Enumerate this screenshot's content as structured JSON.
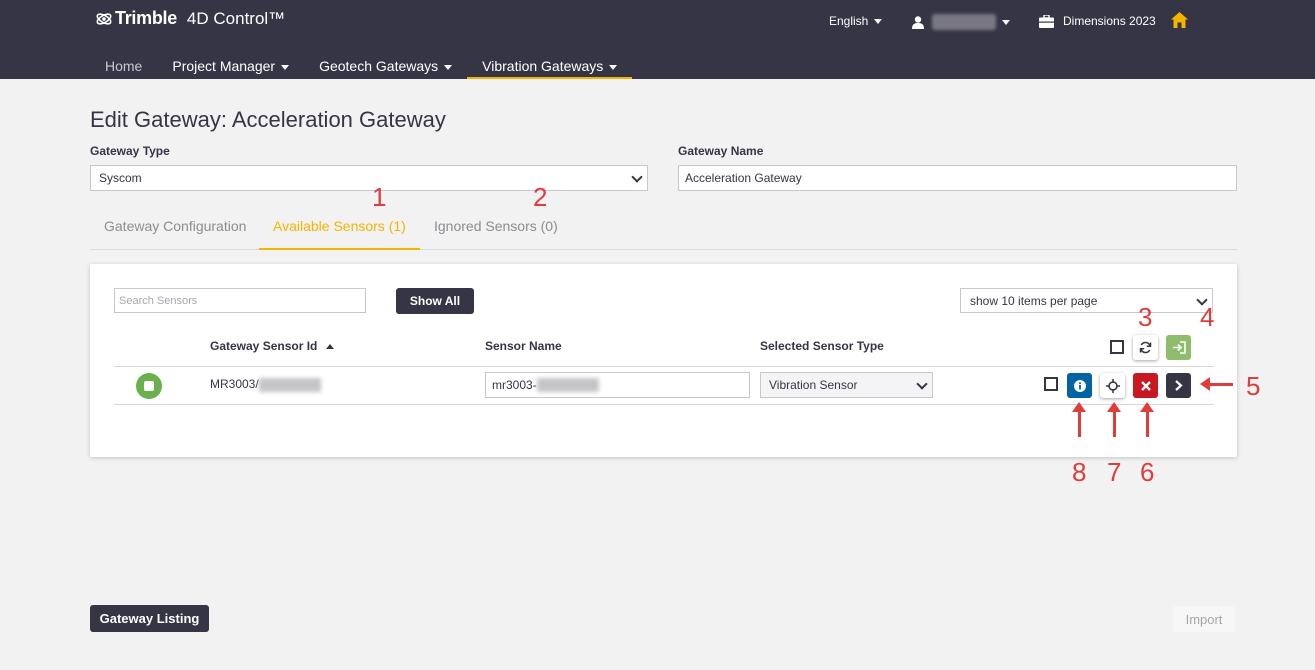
{
  "header": {
    "brand": "Trimble",
    "product": "4D Control™",
    "language": "English",
    "project": "Dimensions 2023"
  },
  "nav": {
    "items": [
      {
        "label": "Home"
      },
      {
        "label": "Project Manager"
      },
      {
        "label": "Geotech Gateways"
      },
      {
        "label": "Vibration Gateways"
      }
    ]
  },
  "page": {
    "title": "Edit Gateway: Acceleration Gateway"
  },
  "form": {
    "gateway_type_label": "Gateway Type",
    "gateway_type_value": "Syscom",
    "gateway_name_label": "Gateway Name",
    "gateway_name_value": "Acceleration Gateway"
  },
  "tabs": [
    {
      "label": "Gateway Configuration"
    },
    {
      "label": "Available Sensors (1)"
    },
    {
      "label": "Ignored Sensors (0)"
    }
  ],
  "sensors": {
    "search_placeholder": "Search Sensors",
    "show_all_label": "Show All",
    "per_page": "show 10 items per page",
    "columns": [
      "Gateway Sensor Id",
      "Sensor Name",
      "Selected Sensor Type"
    ],
    "rows": [
      {
        "id_prefix": "MR3003/",
        "name_prefix": "mr3003-",
        "type": "Vibration Sensor"
      }
    ]
  },
  "footer": {
    "listing_label": "Gateway Listing",
    "import_label": "Import"
  },
  "annotations": [
    "1",
    "2",
    "3",
    "4",
    "5",
    "6",
    "7",
    "8"
  ],
  "colors": {
    "header_bg": "#363545",
    "accent": "#f5b400",
    "info_blue": "#0063a3",
    "delete_red": "#c81922",
    "import_green": "#8fbd6e",
    "annotation_red": "#e03c3c"
  }
}
